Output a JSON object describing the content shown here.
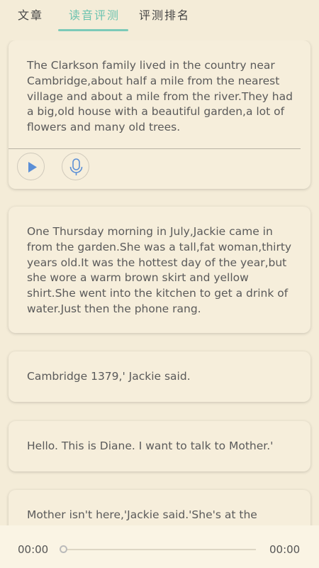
{
  "tabs": [
    "文章",
    "读音评测",
    "评测排名"
  ],
  "active_tab": 1,
  "colors": {
    "accent": "#6cc3b0",
    "background": "#f4ecd8",
    "play": "#5b8fd6"
  },
  "paragraphs": [
    "The Clarkson family lived in the country near Cambridge,about half a mile from the nearest village and about a mile from the river.They had a big,old house with a beautiful garden,a lot of flowers and many old trees.",
    "One Thursday morning in July,Jackie came in from the garden.She was a tall,fat woman,thirty years old.It was the hottest day of the year,but she wore a warm brown skirt and yellow shirt.She went into the kitchen to get a drink of water.Just then the phone rang.",
    "Cambridge 1379,' Jackie said.",
    "Hello. This is Diane. I want to talk to Mother.'",
    "Mother isn't here,'Jackie said.'She's at the"
  ],
  "controls": {
    "play_icon": "play-icon",
    "mic_icon": "microphone-icon"
  },
  "player": {
    "current_time": "00:00",
    "duration": "00:00",
    "progress": 0
  }
}
